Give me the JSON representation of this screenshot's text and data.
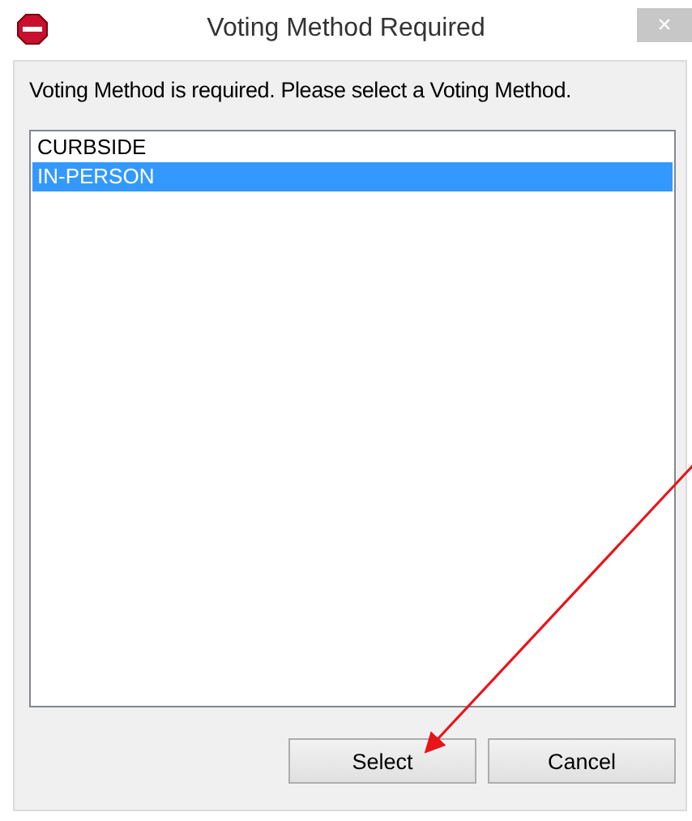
{
  "window": {
    "title": "Voting Method Required",
    "close": "×"
  },
  "message": "Voting Method is required. Please select a Voting Method.",
  "list": [
    {
      "label": "CURBSIDE",
      "selected": false
    },
    {
      "label": "IN-PERSON",
      "selected": true
    }
  ],
  "buttons": [
    {
      "label": "Select"
    },
    {
      "label": "Cancel"
    }
  ]
}
